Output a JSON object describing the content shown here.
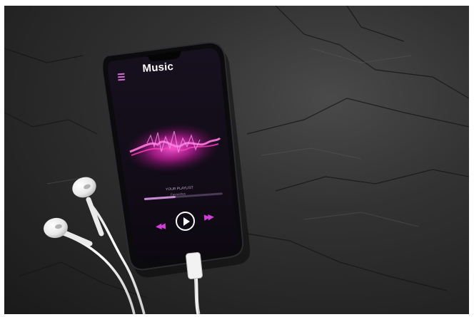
{
  "app": {
    "title": "Music",
    "menu_icon": "hamburger-menu-icon"
  },
  "player": {
    "playlist_label": "YOUR PLAYLIST",
    "track_name": "Favourites",
    "progress": 0.4,
    "controls": {
      "prev_icon": "rewind-icon",
      "play_icon": "play-icon",
      "next_icon": "fast-forward-icon"
    }
  },
  "colors": {
    "accent": "#d23fd8",
    "waveform": "#ff3fbf",
    "slate": "#2a2a2a"
  }
}
